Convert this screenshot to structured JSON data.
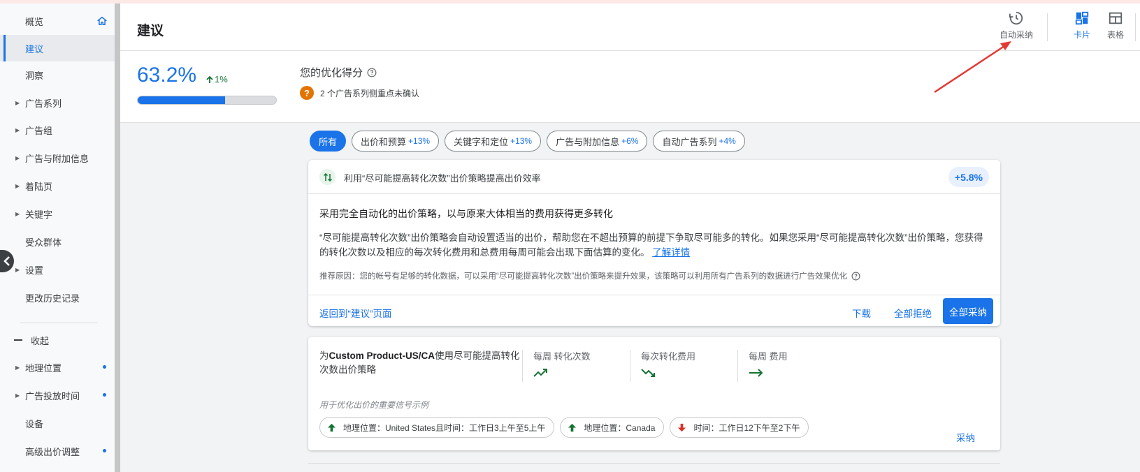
{
  "sidebar": {
    "items": [
      {
        "label": "概览",
        "caret": false
      },
      {
        "label": "建议",
        "caret": false,
        "active": true
      },
      {
        "label": "洞察",
        "caret": false
      },
      {
        "label": "广告系列",
        "caret": true
      },
      {
        "label": "广告组",
        "caret": true
      },
      {
        "label": "广告与附加信息",
        "caret": true
      },
      {
        "label": "着陆页",
        "caret": true
      },
      {
        "label": "关键字",
        "caret": true
      },
      {
        "label": "受众群体",
        "caret": false
      },
      {
        "label": "设置",
        "caret": true
      },
      {
        "label": "更改历史记录",
        "caret": false
      }
    ],
    "collapse_label": "收起",
    "more_items": [
      {
        "label": "地理位置",
        "caret": true,
        "dot": true
      },
      {
        "label": "广告投放时间",
        "caret": true,
        "dot": true
      },
      {
        "label": "设备",
        "caret": false,
        "dot": false
      },
      {
        "label": "高级出价调整",
        "caret": false,
        "dot": true
      }
    ],
    "caret_glyph": "▶"
  },
  "header": {
    "title": "建议",
    "tools": {
      "auto_apply": "自动采纳",
      "cards": "卡片",
      "table": "表格"
    }
  },
  "score": {
    "value": "63.2%",
    "change": "1%",
    "progress_percent": 63.2,
    "title": "您的优化得分",
    "note": "2 个广告系列侧重点未确认",
    "q_mark": "?"
  },
  "filters": [
    {
      "label": "所有",
      "pct": "",
      "active": true
    },
    {
      "label": "出价和预算",
      "pct": "+13%"
    },
    {
      "label": "关键字和定位",
      "pct": "+13%"
    },
    {
      "label": "广告与附加信息",
      "pct": "+6%"
    },
    {
      "label": "自动广告系列",
      "pct": "+4%"
    }
  ],
  "card": {
    "title": "利用“尽可能提高转化次数”出价策略提高出价效率",
    "lift": "+5.8%",
    "subtitle": "采用完全自动化的出价策略，以与原来大体相当的费用获得更多转化",
    "desc": "“尽可能提高转化次数”出价策略会自动设置适当的出价，帮助您在不超出预算的前提下争取尽可能多的转化。如果您采用“尽可能提高转化次数”出价策略，您获得的转化次数以及相应的每次转化费用和总费用每周可能会出现下面估算的变化。",
    "learn_more": "了解详情",
    "reason": "推荐原因：您的帐号有足够的转化数据，可以采用“尽可能提高转化次数”出价策略来提升效果，该策略可以利用所有广告系列的数据进行广告效果优化",
    "back": "返回到“建议”页面",
    "download": "下载",
    "dismiss_all": "全部拒绝",
    "apply_all": "全部采纳"
  },
  "card2": {
    "title_prefix": "为",
    "title_bold": "Custom Product-US/CA",
    "title_suffix": "使用尽可能提高转化次数出价策略",
    "metrics": [
      {
        "label": "每周 转化次数",
        "trend": "up"
      },
      {
        "label": "每次转化费用",
        "trend": "down"
      },
      {
        "label": "每周 费用",
        "trend": "flat"
      }
    ],
    "signal_title": "用于优化出价的重要信号示例",
    "signals": [
      {
        "label": "地理位置：United States且时间：工作日3上午至5上午",
        "dir": "up"
      },
      {
        "label": "地理位置：Canada",
        "dir": "up"
      },
      {
        "label": "时间：工作日12下午至2下午",
        "dir": "down"
      }
    ],
    "apply": "采纳"
  },
  "colors": {
    "accent": "#1a73e8",
    "positive": "#137333",
    "negative": "#d93025",
    "warning": "#e37400",
    "annotation": "#e53935"
  }
}
